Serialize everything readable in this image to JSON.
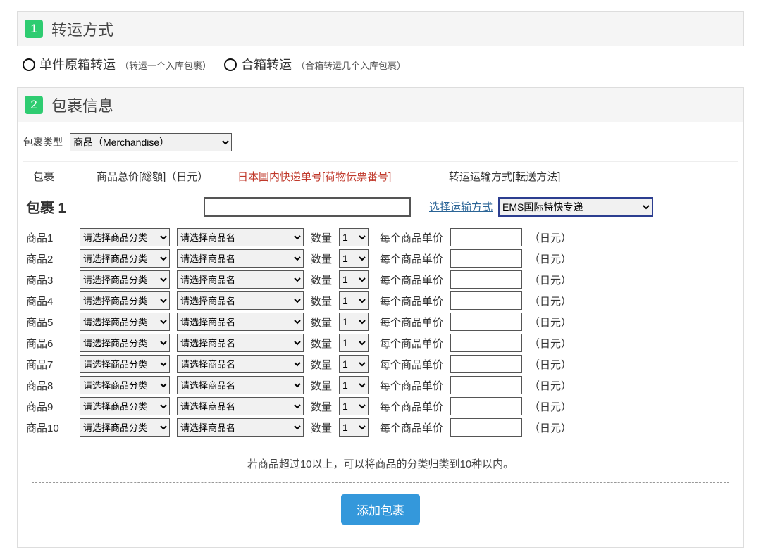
{
  "alert": "",
  "section1": {
    "num": "1",
    "title": "转运方式",
    "opts": [
      {
        "label": "单件原箱转运",
        "desc": "（转运一个入库包裹）"
      },
      {
        "label": "合箱转运",
        "desc": "（合箱转运几个入库包裹）"
      }
    ]
  },
  "section2": {
    "num": "2",
    "title": "包裹信息",
    "pkgtypeLabel": "包裹类型",
    "pkgtypeValue": "商品（Merchandise）",
    "cols": {
      "c1": "包裹",
      "c2": "商品总价[総額]（日元）",
      "c3": "日本国内快递单号[荷物伝票番号]",
      "c4": "转运运输方式[転送方法]"
    },
    "pkg": {
      "name": "包裹 1",
      "chooseLink": "选择运输方式",
      "shipValue": "EMS国际特快专递",
      "rows": [
        {
          "label": "商品1",
          "cat": "请选择商品分类",
          "pname": "请选择商品名",
          "qty": "1"
        },
        {
          "label": "商品2",
          "cat": "请选择商品分类",
          "pname": "请选择商品名",
          "qty": "1"
        },
        {
          "label": "商品3",
          "cat": "请选择商品分类",
          "pname": "请选择商品名",
          "qty": "1"
        },
        {
          "label": "商品4",
          "cat": "请选择商品分类",
          "pname": "请选择商品名",
          "qty": "1"
        },
        {
          "label": "商品5",
          "cat": "请选择商品分类",
          "pname": "请选择商品名",
          "qty": "1"
        },
        {
          "label": "商品6",
          "cat": "请选择商品分类",
          "pname": "请选择商品名",
          "qty": "1"
        },
        {
          "label": "商品7",
          "cat": "请选择商品分类",
          "pname": "请选择商品名",
          "qty": "1"
        },
        {
          "label": "商品8",
          "cat": "请选择商品分类",
          "pname": "请选择商品名",
          "qty": "1"
        },
        {
          "label": "商品9",
          "cat": "请选择商品分类",
          "pname": "请选择商品名",
          "qty": "1"
        },
        {
          "label": "商品10",
          "cat": "请选择商品分类",
          "pname": "请选择商品名",
          "qty": "1"
        }
      ],
      "qtyLabel": "数量",
      "priceLabel": "每个商品单价",
      "yen": "（日元）"
    },
    "note": "若商品超过10以上，可以将商品的分类归类到10种以内。",
    "addBtn": "添加包裹"
  }
}
